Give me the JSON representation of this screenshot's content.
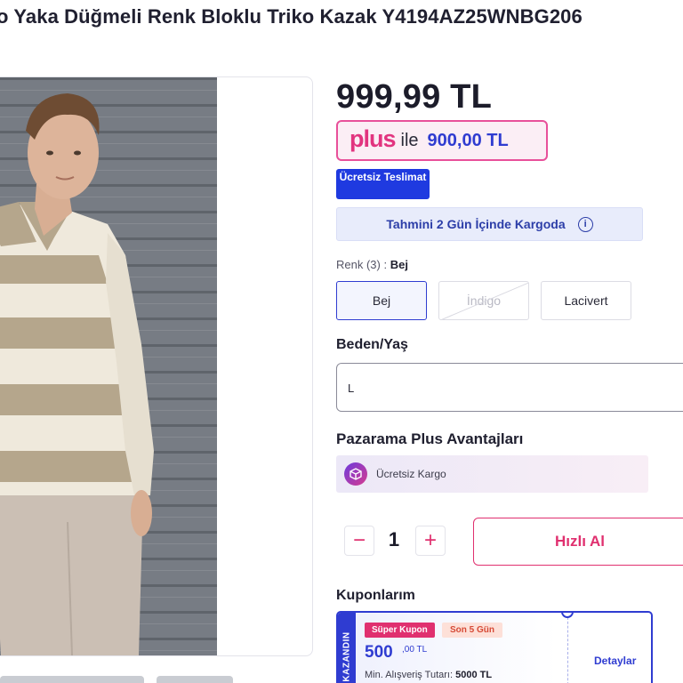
{
  "product": {
    "title": "o Yaka Düğmeli Renk Bloklu Triko Kazak Y4194AZ25WNBG206"
  },
  "price": {
    "amount": "999,99 TL",
    "plus_logo": "plus",
    "plus_connector": "ile",
    "plus_amount": "900,00 TL",
    "free_delivery_badge": "Ücretsiz Teslimat"
  },
  "shipping": {
    "estimate": "Tahmini 2 Gün İçinde Kargoda",
    "info_icon": "info-icon"
  },
  "colors": {
    "label": "Renk (3) :",
    "selected": "Bej",
    "options": [
      {
        "label": "Bej",
        "state": "selected"
      },
      {
        "label": "İndigo",
        "state": "disabled"
      },
      {
        "label": "Lacivert",
        "state": "available"
      }
    ]
  },
  "size": {
    "label": "Beden/Yaş",
    "value": "L"
  },
  "plus_advantages": {
    "title": "Pazarama Plus Avantajları",
    "items": [
      {
        "icon": "box-icon",
        "label": "Ücretsiz Kargo"
      }
    ]
  },
  "quantity": {
    "minus": "−",
    "value": "1",
    "plus": "+"
  },
  "buy_button": "Hızlı Al",
  "coupons": {
    "title": "Kuponlarım",
    "side_label": "KAZANDIN",
    "items": [
      {
        "super_tag": "Süper Kupon",
        "days_tag": "Son 5 Gün",
        "amount": "500",
        "decimals": ",00 TL",
        "min_label": "Min. Alışveriş Tutarı:",
        "min_value": "5000 TL",
        "details": "Detaylar"
      }
    ]
  },
  "theme": {
    "accent_blue": "#2f3cd1",
    "accent_pink": "#e0306f",
    "badge_blue": "#1f3ae0"
  }
}
